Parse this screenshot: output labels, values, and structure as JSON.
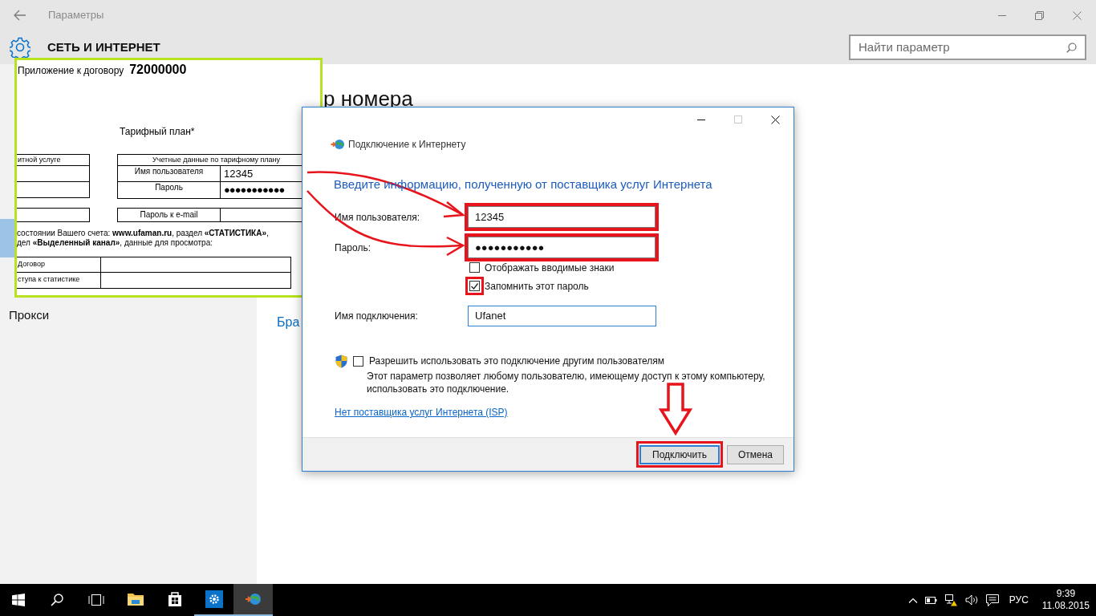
{
  "settings_window": {
    "title": "Параметры",
    "section": "СЕТЬ И ИНТЕРНЕТ",
    "search": {
      "placeholder": "Найти параметр"
    },
    "sidebar": {
      "items": [
        {
          "selected": false
        },
        {
          "selected": false
        },
        {
          "selected": false
        },
        {
          "selected": false
        },
        {
          "selected": true
        },
        {
          "selected": false
        },
        {
          "label": "Прокси",
          "selected": false
        }
      ]
    },
    "heading": "р номера",
    "link": "Бра"
  },
  "document": {
    "caption": "Приложение к договору",
    "contract_number": "72000000",
    "plan_title": "Тарифный план*",
    "left_table_header": "итной услуге",
    "credentials_table": {
      "header": "Учетные данные по тарифному плану",
      "rows": [
        {
          "label": "Имя пользователя",
          "value": "12345"
        },
        {
          "label": "Пароль",
          "value": "●●●●●●●●●●●"
        }
      ]
    },
    "email_row": "Пароль к e-mail",
    "note_lines": [
      "состоянии Вашего счета: **www.ufaman.ru**, раздел **«СТАТИСТИКА»**,",
      "дел **«Выделенный канал»**, данные для просмотра:"
    ],
    "stats_rows": [
      "Договор",
      "ступа к статистике"
    ]
  },
  "dialog": {
    "title": "Подключение к Интернету",
    "heading": "Введите информацию, полученную от поставщика услуг Интернета",
    "fields": [
      {
        "label": "Имя пользователя:",
        "value": "12345",
        "highlighted": true
      },
      {
        "label": "Пароль:",
        "value": "●●●●●●●●●●●",
        "highlighted": true
      }
    ],
    "checkboxes": [
      {
        "label": "Отображать вводимые знаки",
        "checked": false,
        "highlighted": false
      },
      {
        "label": "Запомнить этот пароль",
        "checked": true,
        "highlighted": true
      }
    ],
    "connection_name": {
      "label": "Имя подключения:",
      "value": "Ufanet"
    },
    "share": {
      "label": "Разрешить использовать это подключение другим пользователям",
      "checked": false,
      "description": "Этот параметр позволяет любому пользователю, имеющему доступ к этому компьютеру, использовать это подключение."
    },
    "isp_link": "Нет поставщика услуг Интернета (ISP)",
    "buttons": [
      {
        "label": "Подключить",
        "default": true,
        "highlighted": true
      },
      {
        "label": "Отмена",
        "default": false,
        "highlighted": false
      }
    ]
  },
  "taskbar": {
    "apps": [
      {
        "kind": "explorer",
        "running": false,
        "focused": false
      },
      {
        "kind": "store",
        "running": false,
        "focused": false
      },
      {
        "kind": "settings",
        "running": true,
        "focused": false
      },
      {
        "kind": "dialup",
        "running": true,
        "focused": true
      }
    ],
    "language": "РУС",
    "time": "9:39",
    "date": "11.08.2015"
  }
}
